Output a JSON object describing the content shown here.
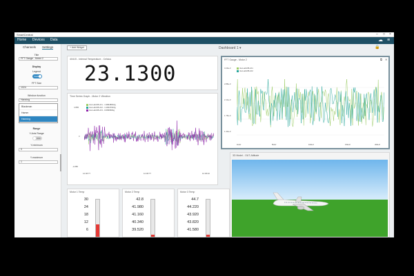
{
  "window": {
    "title": "SmartCentral"
  },
  "nav": {
    "items": [
      "Home",
      "Devices",
      "Data"
    ]
  },
  "sidebar": {
    "tabs": [
      "Channels",
      "Settings"
    ],
    "title_label": "Title",
    "title_value": "FFT Gauge - Motor 2",
    "display_label": "Display",
    "legend_label": "Legend",
    "legend_toggle": "Visible",
    "fft_size_label": "FFT Size",
    "fft_size_value": "1024",
    "window_fn_label": "Window function",
    "window_fn_value": "Hanning",
    "window_options": [
      "Blackman",
      "Hamm",
      "Hanning"
    ],
    "range_label": "Range",
    "fixed_range_label": "Y-Axis Range",
    "fixed_range_toggle": "OFF",
    "ymin_label": "Y-minimum",
    "ymin_value": "0",
    "ymax_label": "Y-maximum",
    "ymax_value": "1"
  },
  "toolbar": {
    "add_widget": "+ Add Widget",
    "dashboard": "Dashboard 1 ▾"
  },
  "panels": {
    "temp": {
      "title": "4041S - Internal Temperature - Celsius",
      "value": "23.1300"
    },
    "timeseries": {
      "title": "Time Series Graph - Motor 2 Vibration",
      "legend": [
        "4xxx-abc95-ch1 - 1.38648642g",
        "4xxx-abc95-ch2 - 1.18447616g",
        "4xxx-abc95-ch3 - 0.0836664g"
      ],
      "yticks": [
        "4.885",
        "0",
        "-4.885"
      ],
      "xticks": [
        "12:38:??",
        "12:38:??",
        "12:38:40"
      ]
    },
    "fft": {
      "title": "FFT Gauge - Motor 2",
      "legend": [
        "4xxx-abc95-ch1",
        "4xxx-abc95-ch2"
      ],
      "yticks": [
        "3.29e-3",
        "2.88e-3",
        "2.14e-3",
        "1.78e-3",
        "1.43e-3",
        "1.07e-3"
      ],
      "xticks": [
        "1kHz",
        "5kHz",
        "10kHz",
        "15kHz",
        "20kHz"
      ]
    },
    "motor1": {
      "title": "Motor 1 Temp",
      "ticks": [
        "30",
        "24",
        "18",
        "12",
        "6"
      ],
      "level": 0.33
    },
    "motor2": {
      "title": "Motor 2 Temp",
      "ticks": [
        "42.8",
        "41.980",
        "41.160",
        "40.340",
        "39.520"
      ],
      "level": 0.05
    },
    "motor3": {
      "title": "Motor 3 Temp",
      "ticks": [
        "44.7",
        "44.220",
        "43.920",
        "43.820",
        "41.580"
      ],
      "level": 0.05
    },
    "model3d": {
      "title": "3D Model - OUT-Attitude"
    }
  },
  "colors": {
    "accent": "#1e4f64",
    "series1": "#8e24aa",
    "series2": "#26a69a",
    "series3": "#9ccc65",
    "alarm": "#e53935"
  }
}
